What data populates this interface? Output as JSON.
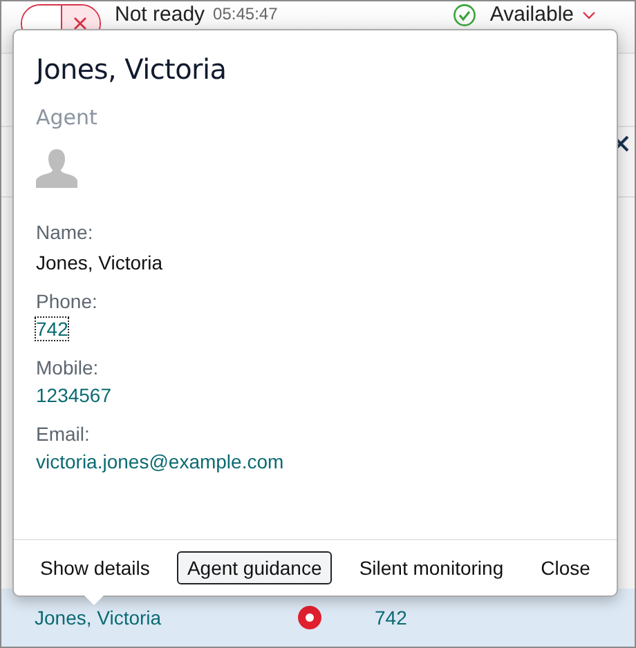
{
  "toolbar": {
    "state_label": "Not ready",
    "timer": "05:45:47",
    "status": "Available",
    "state_buttons": [
      {
        "selected": false
      },
      {
        "selected": true
      }
    ]
  },
  "popup": {
    "title": "Jones, Victoria",
    "role": "Agent",
    "fields": [
      {
        "label": "Name:",
        "value": "Jones, Victoria",
        "kind": "text",
        "focused": false
      },
      {
        "label": "Phone:",
        "value": "742",
        "kind": "link",
        "focused": true
      },
      {
        "label": "Mobile:",
        "value": "1234567",
        "kind": "link",
        "focused": false
      },
      {
        "label": "Email:",
        "value": "victoria.jones@example.com",
        "kind": "link",
        "focused": false
      }
    ],
    "buttons": [
      {
        "label": "Show details",
        "focused": false
      },
      {
        "label": "Agent guidance",
        "focused": true
      },
      {
        "label": "Silent monitoring",
        "focused": false
      },
      {
        "label": "Close",
        "focused": false
      }
    ]
  },
  "row": {
    "name": "Jones, Victoria",
    "extension": "742"
  }
}
